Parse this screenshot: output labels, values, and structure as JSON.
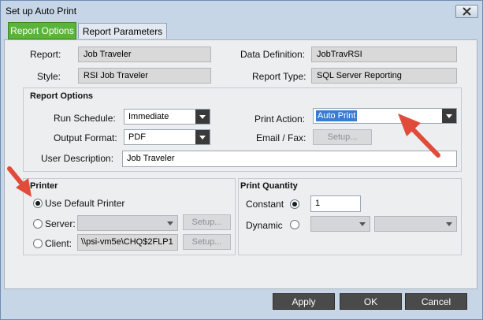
{
  "window": {
    "title": "Set up Auto Print"
  },
  "tabs": [
    {
      "label": "Report Options",
      "active": true
    },
    {
      "label": "Report Parameters",
      "active": false
    }
  ],
  "header": {
    "report_label": "Report:",
    "report_value": "Job Traveler",
    "style_label": "Style:",
    "style_value": "RSI Job Traveler",
    "data_def_label": "Data Definition:",
    "data_def_value": "JobTravRSI",
    "report_type_label": "Report Type:",
    "report_type_value": "SQL Server Reporting"
  },
  "report_options": {
    "heading": "Report Options",
    "run_schedule_label": "Run Schedule:",
    "run_schedule_value": "Immediate",
    "output_format_label": "Output Format:",
    "output_format_value": "PDF",
    "print_action_label": "Print Action:",
    "print_action_value": "Auto Print",
    "email_fax_label": "Email / Fax:",
    "email_setup_label": "Setup...",
    "user_desc_label": "User Description:",
    "user_desc_value": "Job Traveler"
  },
  "printer": {
    "heading": "Printer",
    "use_default_label": "Use Default Printer",
    "use_default_selected": true,
    "server_label": "Server:",
    "server_value": "",
    "server_setup_label": "Setup...",
    "client_label": "Client:",
    "client_value": "\\\\psi-vm5e\\CHQ$2FLP1",
    "client_setup_label": "Setup..."
  },
  "print_quantity": {
    "heading": "Print Quantity",
    "constant_label": "Constant",
    "constant_selected": true,
    "constant_value": "1",
    "dynamic_label": "Dynamic",
    "dynamic_value_1": "",
    "dynamic_value_2": ""
  },
  "footer": {
    "apply_label": "Apply",
    "ok_label": "OK",
    "cancel_label": "Cancel"
  },
  "colors": {
    "tab_active": "#5ab33a",
    "arrow": "#e04b3a",
    "highlight": "#3a7bd5",
    "footer_button": "#4a4a4a"
  }
}
